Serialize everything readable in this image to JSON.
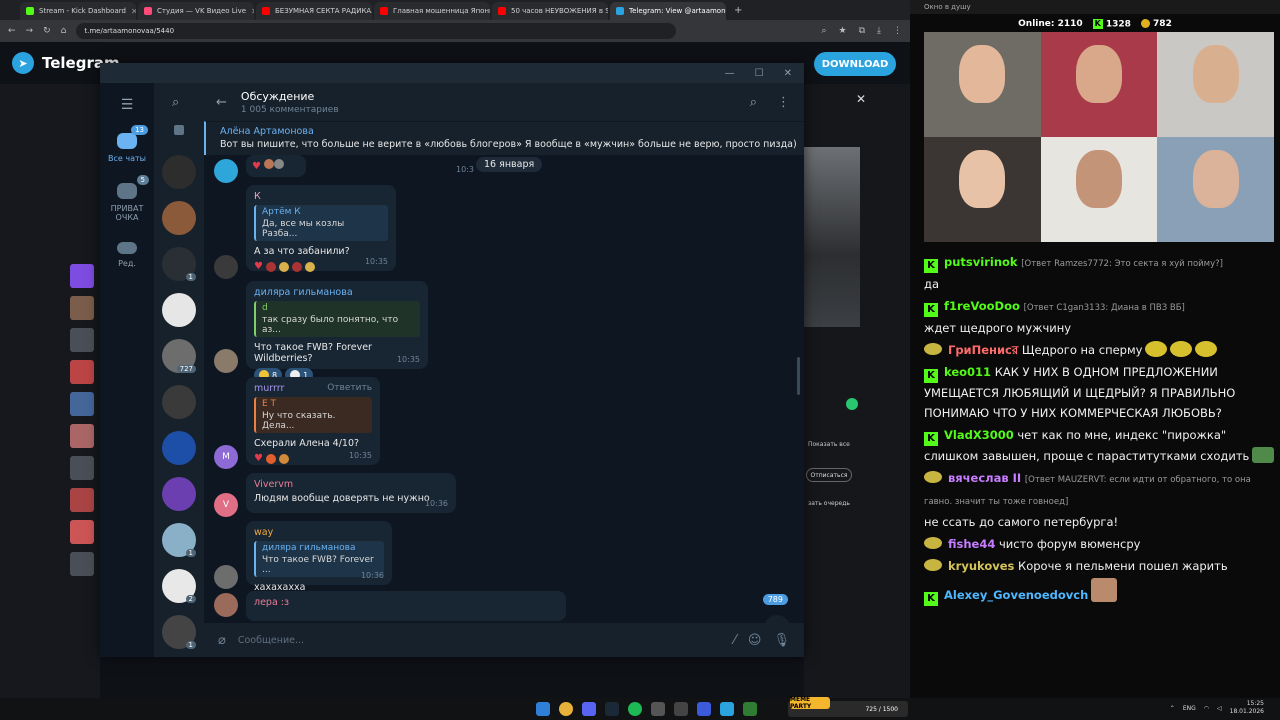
{
  "browser": {
    "tabs": [
      {
        "label": "Stream - Kick Dashboard",
        "color": "#53fc18",
        "active": false
      },
      {
        "label": "Студия — VK Видео Live",
        "color": "#ff4a7a",
        "active": false
      },
      {
        "label": "БЕЗУМНАЯ СЕКТА РАДИКАЛЬ",
        "color": "#ff0000",
        "active": false
      },
      {
        "label": "Главная мошенница Японии",
        "color": "#ff0000",
        "active": false
      },
      {
        "label": "50 часов НЕУВОЖЕНИЯ в SAN",
        "color": "#ff0000",
        "active": false
      },
      {
        "label": "Telegram: View @artaamonovaa",
        "color": "#2aa3df",
        "active": true
      }
    ],
    "new_tab": "+",
    "url": "t.me/artaamonovaa/5440"
  },
  "tgpage": {
    "title": "Telegram",
    "download_label": "DOWNLOAD",
    "right_buttons": [
      "Показать все",
      "Отписаться",
      "зать очередь"
    ],
    "right_close": "✕"
  },
  "telegram": {
    "window_controls": [
      "—",
      "☐",
      "✕"
    ],
    "folders": [
      {
        "label": "Все чаты",
        "badge": "13",
        "active": true
      },
      {
        "label": "ПРИВАТ ОЧКА",
        "badge": "5",
        "active": false
      },
      {
        "label": "Ред.",
        "badge": "",
        "active": false
      }
    ],
    "chat_badges": [
      "1",
      "727",
      "1",
      "1",
      "2",
      "1"
    ],
    "header": {
      "title": "Обсуждение",
      "subtitle": "1 005 комментариев"
    },
    "pinned": {
      "name": "Алёна Артамонова",
      "text": "Вот вы пишите, что больше не верите в «любовь блогеров» Я вообще в «мужчин» больше не верю, просто пизда)"
    },
    "date_divider": "16 января",
    "messages": [
      {
        "sender": "",
        "quote_name": "",
        "quote_text": "",
        "text": "",
        "time": "10:3",
        "reactions": "♥"
      },
      {
        "sender": "К",
        "sender_color": "#e8a3c0",
        "quote_name": "Артём К",
        "quote_text": "Да, все мы козлы  Разба...",
        "quote_color": "#6ab2f2",
        "text": "А за что забанили?",
        "time": "10:35"
      },
      {
        "sender": "диляра гильманова",
        "sender_color": "#6ab2f2",
        "quote_name": "d",
        "quote_text": "так сразу было понятно, что аз...",
        "quote_color": "#7fd068",
        "text": "Что такое FWB? Forever Wildberries?",
        "time": "10:35",
        "react1": "8",
        "react2": "1"
      },
      {
        "sender": "murrrr",
        "sender_color": "#a695e7",
        "reply": "Ответить",
        "quote_name": "Е Т",
        "quote_text": "Ну что сказать. Дела...",
        "quote_color": "#ee7f40",
        "text": "Схерали Алена 4/10?",
        "time": "10:35",
        "avatar_letter": "M"
      },
      {
        "sender": "Vivervm",
        "sender_color": "#e87e96",
        "text": "Людям вообще доверять не нужно",
        "time": "10:36",
        "avatar_letter": "V"
      },
      {
        "sender": "way",
        "sender_color": "#f0a93c",
        "quote_name": "диляра гильманова",
        "quote_text": "Что такое FWB? Forever ...",
        "quote_color": "#6ab2f2",
        "text": "хахахахха",
        "time": "10:36"
      },
      {
        "sender": "лера :з",
        "sender_color": "#e87e96",
        "text": "",
        "time": ""
      }
    ],
    "unread_count": "789",
    "composer_placeholder": "Сообщение..."
  },
  "stream": {
    "window_title": "Окно в душу",
    "online_label": "Online:",
    "online_count": "2110",
    "kick_count": "1328",
    "coin_count": "782",
    "chat": [
      {
        "badge": "kick",
        "user": "putsvirinok",
        "color": "#53fc18",
        "reply": "[Ответ Ramzes7772: Это секта я хуй пойму?]",
        "text": "да"
      },
      {
        "badge": "kick",
        "user": "f1reVooDoo",
        "color": "#53fc18",
        "reply": "[Ответ C1gan3133: Диана в ПВЗ ВБ]",
        "text": "ждет щедрого мужчину"
      },
      {
        "badge": "coin",
        "user": "ГриПенисর",
        "color": "#ff6b6b",
        "reply": "",
        "text": "Щедрого на сперму"
      },
      {
        "badge": "kick",
        "user": "keo011",
        "color": "#53fc18",
        "reply": "",
        "text": "КАК У НИХ В ОДНОМ ПРЕДЛОЖЕНИИ УМЕЩАЕТСЯ ЛЮБЯЩИЙ И ЩЕДРЫЙ? Я ПРАВИЛЬНО ПОНИМАЮ ЧТО У НИХ КОММЕРЧЕСКАЯ ЛЮБОВЬ?"
      },
      {
        "badge": "kick",
        "user": "VladX3000",
        "color": "#53fc18",
        "reply": "",
        "text": "чет как по мне, индекс \"пирожка\" слишком завышен, проще с параститутками сходить"
      },
      {
        "badge": "coin",
        "user": "вячеслав II",
        "color": "#c77dff",
        "reply": "[Ответ MAUZERVT: если идти от обратного, то она гавно. значит ты тоже говноед]",
        "text": "не ссать до самого петербурга!"
      },
      {
        "badge": "coin",
        "user": "fishe44",
        "color": "#c77dff",
        "reply": "",
        "text": "чисто форум вюменсру"
      },
      {
        "badge": "coin",
        "user": "kryukoves",
        "color": "#d4c45a",
        "reply": "",
        "text": "Короче я пельмени пошел жарить"
      },
      {
        "badge": "kick",
        "user": "Alexey_Govenoedovch",
        "color": "#4db8ff",
        "reply": "",
        "text": ""
      }
    ]
  },
  "taskbar": {
    "meme_label": "MEME PARTY",
    "meme_count": "725 / 1500",
    "lang": "ENG",
    "time": "15:25",
    "date": "18.01.2026"
  }
}
